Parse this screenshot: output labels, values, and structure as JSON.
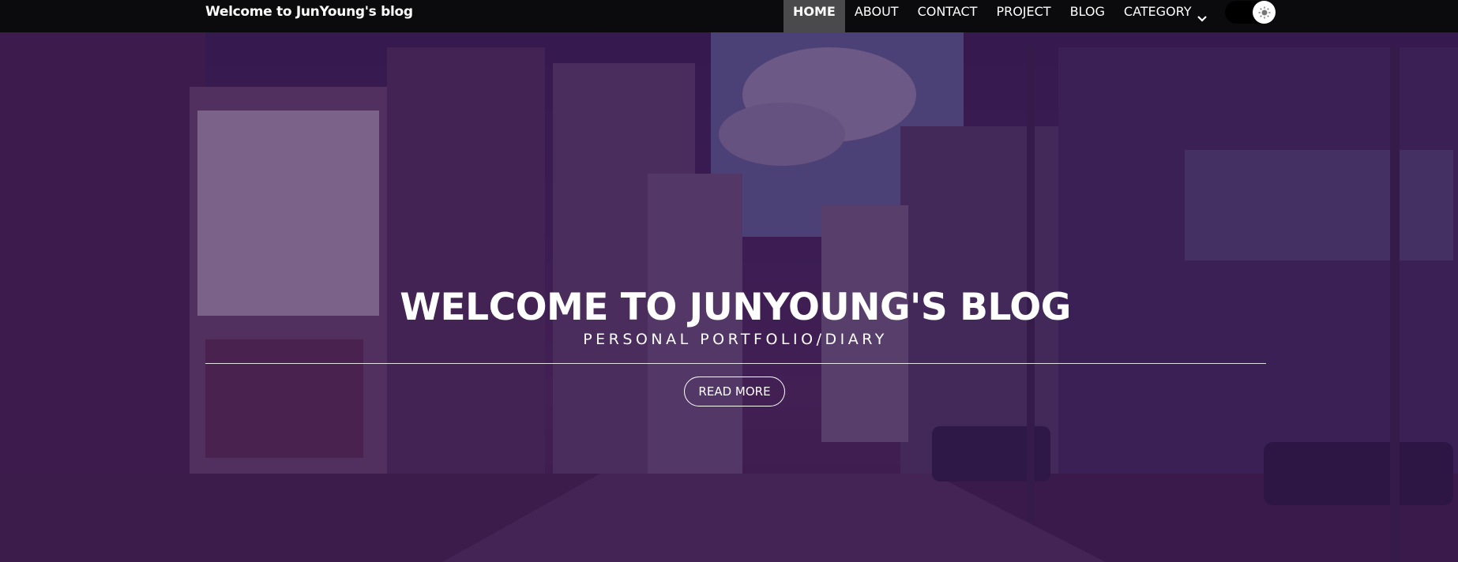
{
  "navbar": {
    "brand": "Welcome to JunYoung's blog",
    "menu": [
      {
        "label": "HOME",
        "active": true
      },
      {
        "label": "ABOUT",
        "active": false
      },
      {
        "label": "CONTACT",
        "active": false
      },
      {
        "label": "PROJECT",
        "active": false
      },
      {
        "label": "BLOG",
        "active": false
      },
      {
        "label": "CATEGORY",
        "active": false,
        "icon": "chevron-down-icon"
      }
    ],
    "theme_toggle_icon": "sun-icon"
  },
  "hero": {
    "title": "WELCOME TO JUNYOUNG'S BLOG",
    "subtitle": "PERSONAL PORTFOLIO/DIARY",
    "button_label": "READ MORE",
    "background_image": "street-scene",
    "overlay_color": "#300e48"
  }
}
